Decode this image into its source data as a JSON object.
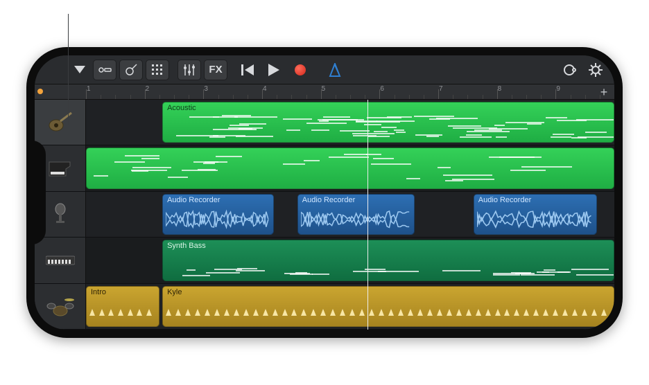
{
  "toolbar": {
    "browser_icon": "chevron-down",
    "view_icon": "tracks-view",
    "instrument_icon": "guitar",
    "grid_icon": "grid",
    "mixer_icon": "sliders",
    "fx_label": "FX",
    "rewind_icon": "skip-back",
    "play_icon": "play",
    "record_icon": "record",
    "metronome_icon": "metronome",
    "loop_icon": "loop",
    "settings_icon": "gear"
  },
  "ruler": {
    "bars": [
      1,
      2,
      3,
      4,
      5,
      6,
      7,
      8,
      9
    ],
    "playhead_bar": 5.8,
    "add_label": "+"
  },
  "tracks": [
    {
      "id": "acoustic",
      "instrument": "Acoustic Guitar",
      "icon": "guitar",
      "selected": true,
      "regions": [
        {
          "label": "Acoustic",
          "color": "green2",
          "start": 1.3,
          "end": 9.0,
          "content": "midi"
        }
      ]
    },
    {
      "id": "piano",
      "instrument": "Piano",
      "icon": "piano",
      "selected": false,
      "regions": [
        {
          "label": "",
          "color": "green2",
          "start": 0.0,
          "end": 9.0,
          "content": "midi-sparse"
        }
      ]
    },
    {
      "id": "vocals",
      "instrument": "Audio Recorder",
      "icon": "microphone",
      "selected": false,
      "regions": [
        {
          "label": "Audio Recorder",
          "color": "blue",
          "start": 1.3,
          "end": 3.2,
          "content": "wave"
        },
        {
          "label": "Audio Recorder",
          "color": "blue",
          "start": 3.6,
          "end": 5.6,
          "content": "wave"
        },
        {
          "label": "Audio Recorder",
          "color": "blue",
          "start": 6.6,
          "end": 8.7,
          "content": "wave"
        }
      ]
    },
    {
      "id": "bass",
      "instrument": "Synth Bass",
      "icon": "keyboard",
      "selected": false,
      "regions": [
        {
          "label": "Synth Bass",
          "color": "teal",
          "start": 1.3,
          "end": 9.0,
          "content": "midi-low"
        }
      ]
    },
    {
      "id": "drums",
      "instrument": "Drums",
      "icon": "drums",
      "selected": false,
      "regions": [
        {
          "label": "Intro",
          "color": "yellow",
          "start": 0.0,
          "end": 1.25,
          "content": "hits"
        },
        {
          "label": "Kyle",
          "color": "yellow",
          "start": 1.3,
          "end": 9.0,
          "content": "hits"
        }
      ]
    }
  ],
  "colors": {
    "accent_blue": "#2f7fd1",
    "record_red": "#e23b2a",
    "midi_green": "#2bc24e",
    "audio_blue": "#2d6fb3",
    "drummer_yellow": "#caa530"
  }
}
